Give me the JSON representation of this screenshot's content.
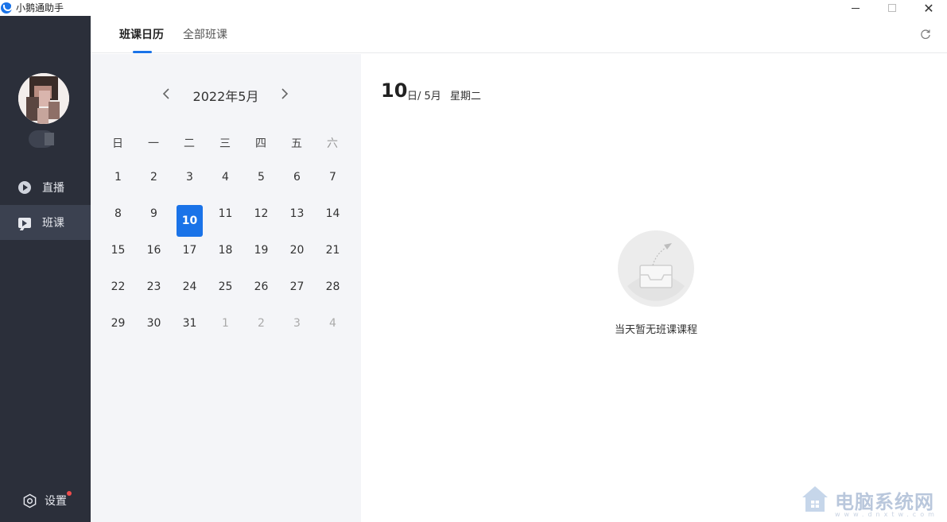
{
  "window": {
    "title": "小鹅通助手",
    "minimize_label": "minimize",
    "maximize_label": "maximize",
    "close_label": "✕"
  },
  "sidebar": {
    "items": [
      {
        "label": "直播",
        "icon": "play-circle-icon"
      },
      {
        "label": "班课",
        "icon": "class-video-icon"
      }
    ],
    "active_index": 1,
    "settings_label": "设置",
    "settings_badge": true
  },
  "tabs": [
    {
      "label": "班课日历"
    },
    {
      "label": "全部班课"
    }
  ],
  "calendar": {
    "month_label": "2022年5月",
    "weekdays": [
      "日",
      "一",
      "二",
      "三",
      "四",
      "五",
      "六"
    ],
    "weeks": [
      [
        "1",
        "2",
        "3",
        "4",
        "5",
        "6",
        "7"
      ],
      [
        "8",
        "9",
        "10",
        "11",
        "12",
        "13",
        "14"
      ],
      [
        "15",
        "16",
        "17",
        "18",
        "19",
        "20",
        "21"
      ],
      [
        "22",
        "23",
        "24",
        "25",
        "26",
        "27",
        "28"
      ],
      [
        "29",
        "30",
        "31",
        "1",
        "2",
        "3",
        "4"
      ]
    ],
    "selected_day": "10"
  },
  "detail": {
    "day": "10",
    "day_month": "日/ 5月",
    "weekday": "星期二",
    "empty_message": "当天暂无班课课程"
  },
  "watermark": {
    "text": "电脑系统网",
    "sub": "www.dnxtw.com"
  },
  "colors": {
    "accent": "#1a73e8",
    "sidebar_bg": "#2b2f3a",
    "calendar_bg": "#f4f5f8"
  }
}
